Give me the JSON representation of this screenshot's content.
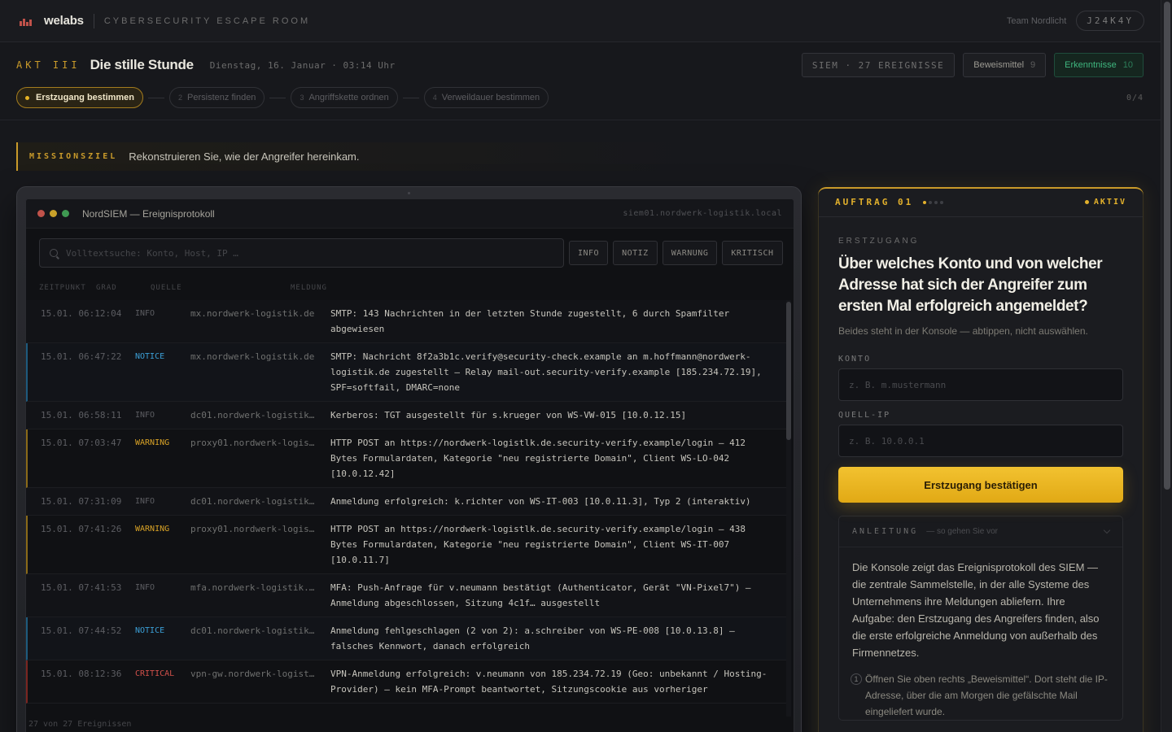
{
  "topbar": {
    "brand": "welabs",
    "subtitle": "CYBERSECURITY ESCAPE ROOM",
    "team": "Team Nordlicht",
    "code": "J24K4Y"
  },
  "header": {
    "act_label": "AKT III",
    "act_title": "Die stille Stunde",
    "date": "Dienstag, 16. Januar · 03:14 Uhr",
    "siem_label": "SIEM · 27 EREIGNISSE",
    "evidence_label": "Beweismittel",
    "evidence_count": "9",
    "findings_label": "Erkenntnisse",
    "findings_count": "10"
  },
  "steps": {
    "items": [
      {
        "num": "",
        "label": "Erstzugang bestimmen"
      },
      {
        "num": "2",
        "label": "Persistenz finden"
      },
      {
        "num": "3",
        "label": "Angriffskette ordnen"
      },
      {
        "num": "4",
        "label": "Verweildauer bestimmen"
      }
    ],
    "progress": "0/4"
  },
  "mission": {
    "label": "MISSIONSZIEL",
    "text": "Rekonstruieren Sie, wie der Angreifer hereinkam."
  },
  "console": {
    "title": "NordSIEM — Ereignisprotokoll",
    "host": "siem01.nordwerk-logistik.local",
    "search_placeholder": "Volltextsuche: Konto, Host, IP …",
    "filters": [
      "INFO",
      "NOTIZ",
      "WARNUNG",
      "KRITISCH"
    ],
    "columns": {
      "time": "ZEITPUNKT",
      "sev": "GRAD",
      "src": "QUELLE",
      "msg": "MELDUNG"
    },
    "rows": [
      {
        "time": "15.01. 06:12:04",
        "sev": "INFO",
        "src": "mx.nordwerk-logistik.de",
        "msg": "SMTP: 143 Nachrichten in der letzten Stunde zugestellt, 6 durch Spamfilter abgewiesen"
      },
      {
        "time": "15.01. 06:47:22",
        "sev": "NOTICE",
        "src": "mx.nordwerk-logistik.de",
        "msg": "SMTP: Nachricht 8f2a3b1c.verify@security-check.example an m.hoffmann@nordwerk-logistik.de zugestellt — Relay mail-out.security-verify.example [185.234.72.19], SPF=softfail, DMARC=none"
      },
      {
        "time": "15.01. 06:58:11",
        "sev": "INFO",
        "src": "dc01.nordwerk-logistik…",
        "msg": "Kerberos: TGT ausgestellt für s.krueger von WS-VW-015 [10.0.12.15]"
      },
      {
        "time": "15.01. 07:03:47",
        "sev": "WARNING",
        "src": "proxy01.nordwerk-logis…",
        "msg": "HTTP POST an https://nordwerk-logistlk.de.security-verify.example/login — 412 Bytes Formulardaten, Kategorie \"neu registrierte Domain\", Client WS-LO-042 [10.0.12.42]"
      },
      {
        "time": "15.01. 07:31:09",
        "sev": "INFO",
        "src": "dc01.nordwerk-logistik…",
        "msg": "Anmeldung erfolgreich: k.richter von WS-IT-003 [10.0.11.3], Typ 2 (interaktiv)"
      },
      {
        "time": "15.01. 07:41:26",
        "sev": "WARNING",
        "src": "proxy01.nordwerk-logis…",
        "msg": "HTTP POST an https://nordwerk-logistlk.de.security-verify.example/login — 438 Bytes Formulardaten, Kategorie \"neu registrierte Domain\", Client WS-IT-007 [10.0.11.7]"
      },
      {
        "time": "15.01. 07:41:53",
        "sev": "INFO",
        "src": "mfa.nordwerk-logistik.…",
        "msg": "MFA: Push-Anfrage für v.neumann bestätigt (Authenticator, Gerät \"VN-Pixel7\") — Anmeldung abgeschlossen, Sitzung 4c1f… ausgestellt"
      },
      {
        "time": "15.01. 07:44:52",
        "sev": "NOTICE",
        "src": "dc01.nordwerk-logistik…",
        "msg": "Anmeldung fehlgeschlagen (2 von 2): a.schreiber von WS-PE-008 [10.0.13.8] — falsches Kennwort, danach erfolgreich"
      },
      {
        "time": "15.01. 08:12:36",
        "sev": "CRITICAL",
        "src": "vpn-gw.nordwerk-logist…",
        "msg": "VPN-Anmeldung erfolgreich: v.neumann von 185.234.72.19 (Geo: unbekannt / Hosting-Provider) — kein MFA-Prompt beantwortet, Sitzungscookie aus vorheriger"
      }
    ],
    "status": "27 von 27 Ereignissen"
  },
  "panel": {
    "auftrag": "AUFTRAG 01",
    "status": "AKTIV",
    "eyebrow": "ERSTZUGANG",
    "question": "Über welches Konto und von welcher Adresse hat sich der Angreifer zum ersten Mal erfolgreich angemeldet?",
    "hint": "Beides steht in der Konsole — abtippen, nicht auswählen.",
    "account_label": "KONTO",
    "account_placeholder": "z. B. m.mustermann",
    "ip_label": "QUELL-IP",
    "ip_placeholder": "z. B. 10.0.0.1",
    "confirm_label": "Erstzugang bestätigen",
    "guide_title": "ANLEITUNG",
    "guide_subtitle": "— so gehen Sie vor",
    "guide_text": "Die Konsole zeigt das Ereignisprotokoll des SIEM — die zentrale Sammelstelle, in der alle Systeme des Unternehmens ihre Meldungen abliefern. Ihre Aufgabe: den Erstzugang des Angreifers finden, also die erste erfolgreiche Anmeldung von außerhalb des Firmennetzes.",
    "guide_step_num": "1",
    "guide_step_text": "Öffnen Sie oben rechts „Beweismittel“. Dort steht die IP-Adresse, über die am Morgen die gefälschte Mail eingeliefert wurde."
  },
  "colors": {
    "accent": "#e2b02c",
    "notice": "#3b9fd6",
    "warning": "#d8a226",
    "critical": "#d0504a",
    "success": "#3fb77f"
  }
}
